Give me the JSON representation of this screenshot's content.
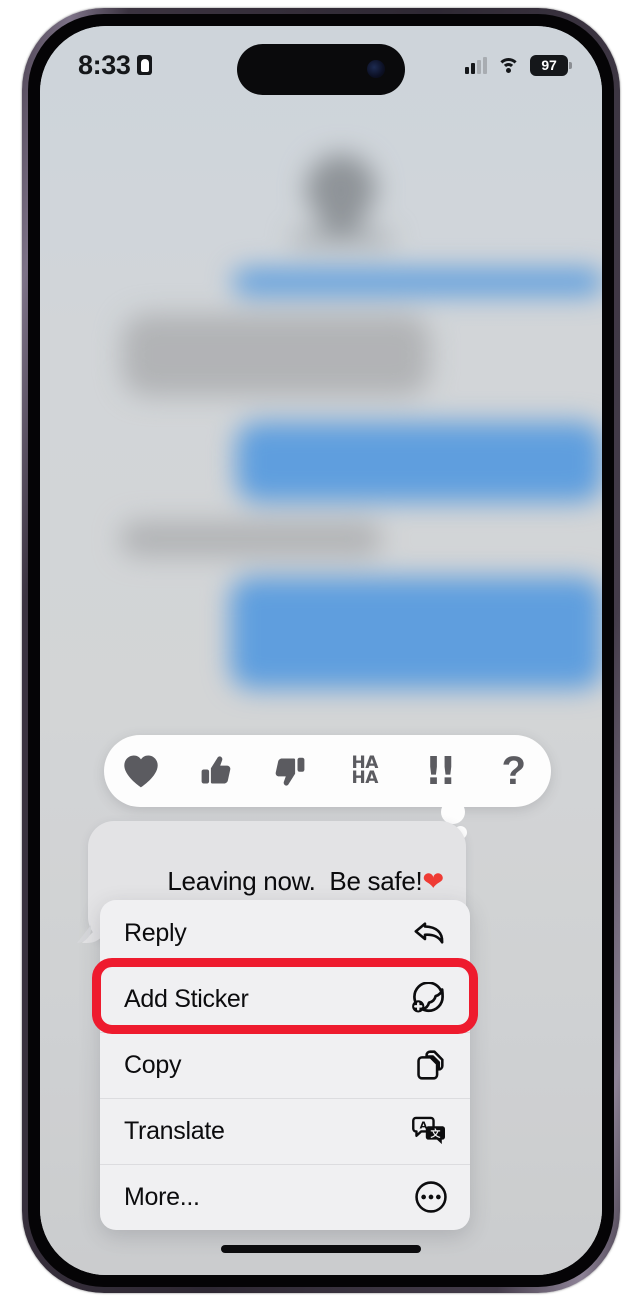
{
  "device": {
    "name": "iphone-14-pro",
    "frame_color": "#3b3340",
    "buttons": [
      "mute-switch",
      "volume-up",
      "volume-down",
      "power"
    ]
  },
  "status_bar": {
    "time": "8:33",
    "focus_icon": "focus-person-icon",
    "cellular_icon": "cellular-bars-icon",
    "cellular_bars_filled": 2,
    "cellular_bars_total": 4,
    "wifi_icon": "wifi-icon",
    "battery_level": "97",
    "battery_icon": "battery-icon"
  },
  "background": {
    "description": "blurred iMessage conversation",
    "bubble_blue": "#3f8fe0",
    "bubble_gray": "#a9aaad",
    "wallpaper_top": "#cdd4dc",
    "wallpaper_bottom": "#c9cacc"
  },
  "tapback_bar": {
    "items": [
      {
        "name": "heart",
        "icon": "heart-icon",
        "label": ""
      },
      {
        "name": "thumbs-up",
        "icon": "thumbs-up-icon",
        "label": ""
      },
      {
        "name": "thumbs-down",
        "icon": "thumbs-down-icon",
        "label": ""
      },
      {
        "name": "haha",
        "icon": "haha-icon",
        "line1": "HA",
        "line2": "HA"
      },
      {
        "name": "exclamation",
        "icon": "double-exclamation-icon",
        "label": "!!"
      },
      {
        "name": "question",
        "icon": "question-mark-icon",
        "label": "?"
      }
    ],
    "background": "#fdfdfd",
    "icon_color": "#5b5b60"
  },
  "message": {
    "text": "Leaving now.  Be safe!",
    "emoji": "❤",
    "bubble_color": "#e3e3e5",
    "sender": "incoming"
  },
  "context_menu": {
    "items": [
      {
        "label": "Reply",
        "icon": "reply-arrow-icon",
        "highlighted": false
      },
      {
        "label": "Add Sticker",
        "icon": "sticker-plus-icon",
        "highlighted": true
      },
      {
        "label": "Copy",
        "icon": "copy-documents-icon",
        "highlighted": false
      },
      {
        "label": "Translate",
        "icon": "translate-bubbles-icon",
        "highlighted": false
      },
      {
        "label": "More...",
        "icon": "ellipsis-circle-icon",
        "highlighted": false
      }
    ],
    "background": "#f0f0f2"
  },
  "annotation": {
    "highlight_color": "#ee1b2e",
    "target": "Add Sticker"
  },
  "home_indicator": {
    "name": "home-indicator"
  }
}
